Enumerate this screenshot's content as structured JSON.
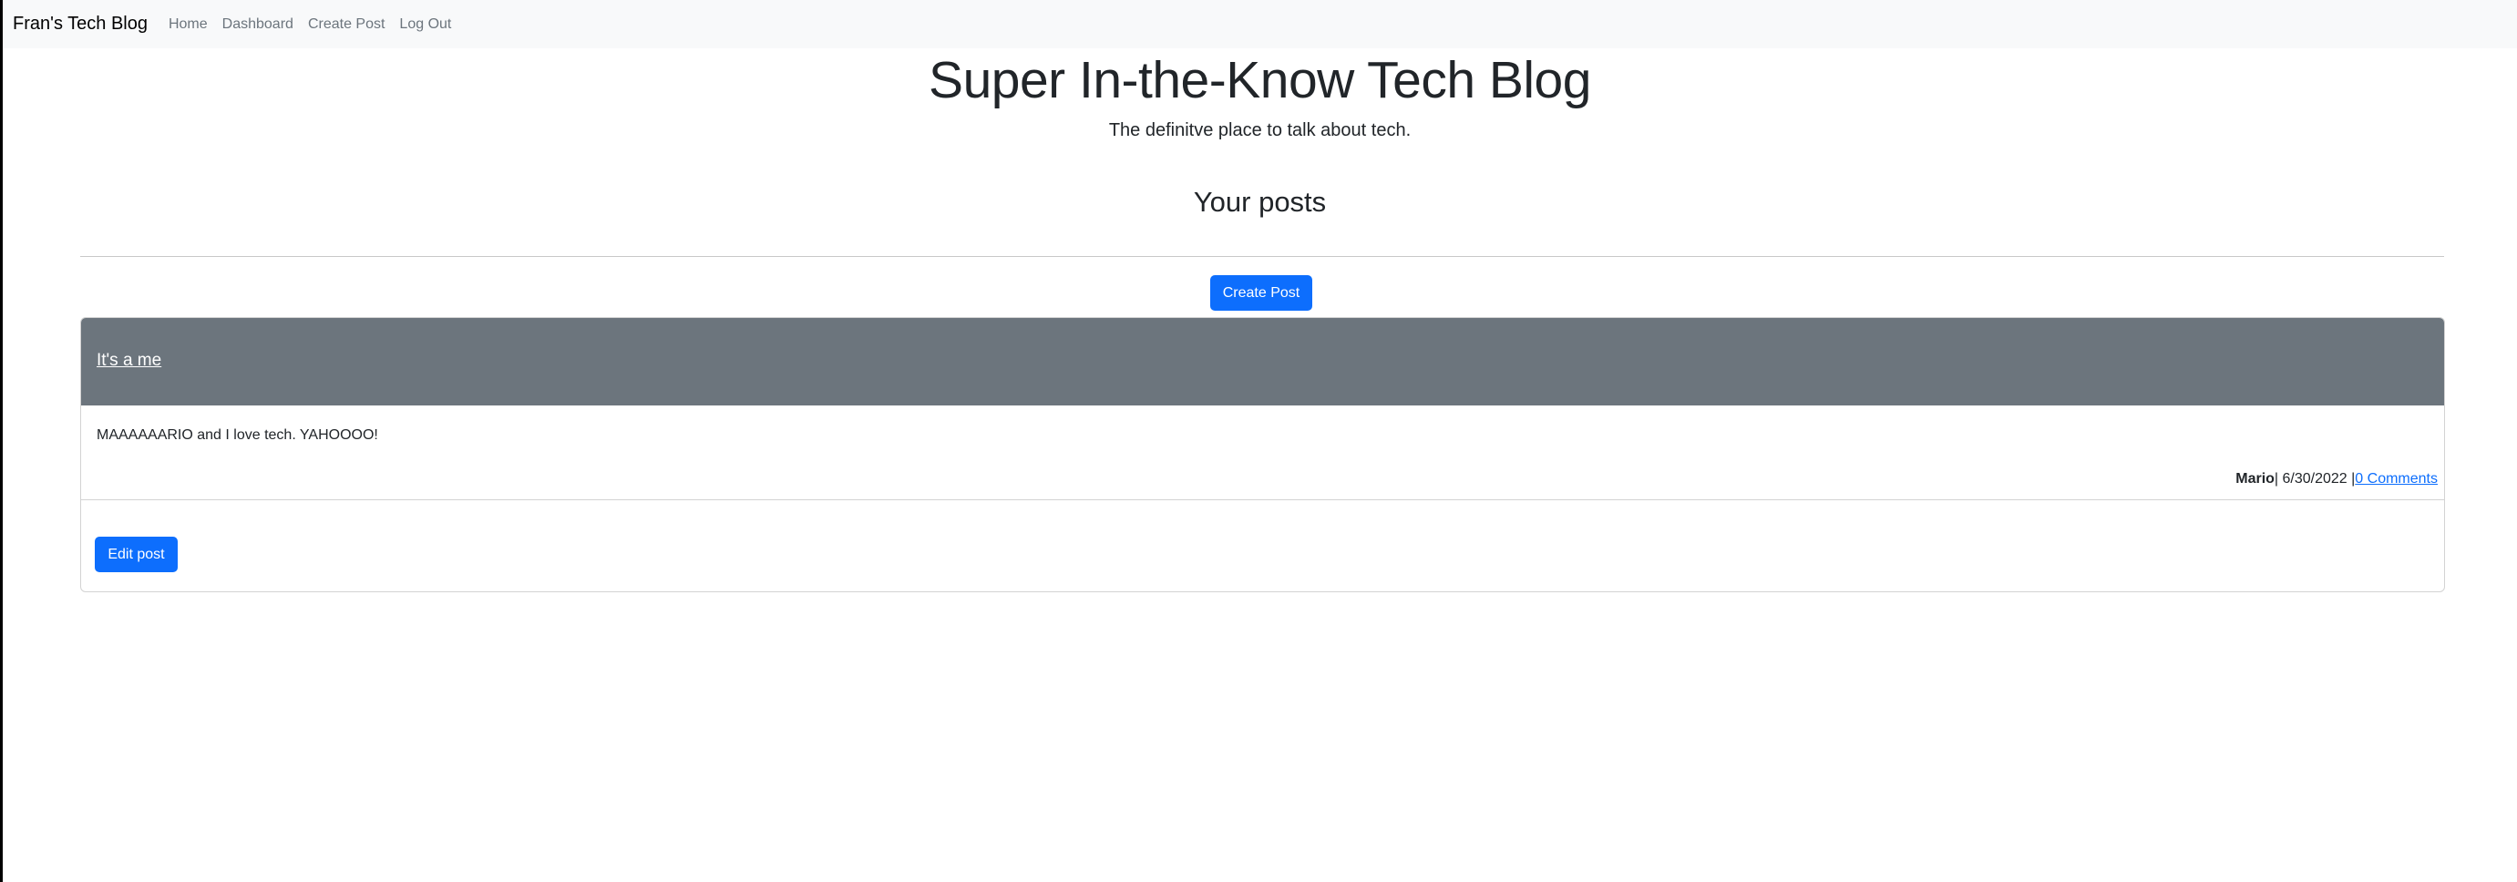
{
  "navbar": {
    "brand": "Fran's Tech Blog",
    "links": [
      "Home",
      "Dashboard",
      "Create Post",
      "Log Out"
    ]
  },
  "hero": {
    "title": "Super In-the-Know Tech Blog",
    "subtitle": "The definitve place to talk about tech."
  },
  "section": {
    "title": "Your posts",
    "create_button": "Create Post"
  },
  "post": {
    "title": "It's a me",
    "content": "MAAAAAARIO and I love tech. YAHOOOO!",
    "author": "Mario",
    "date_text": "| 6/30/2022 |",
    "comments": "0 Comments",
    "edit_button": "Edit post"
  },
  "colors": {
    "primary": "#0d6efd",
    "header_bg": "#6c757d",
    "navbar_bg": "#f8f9fa"
  }
}
